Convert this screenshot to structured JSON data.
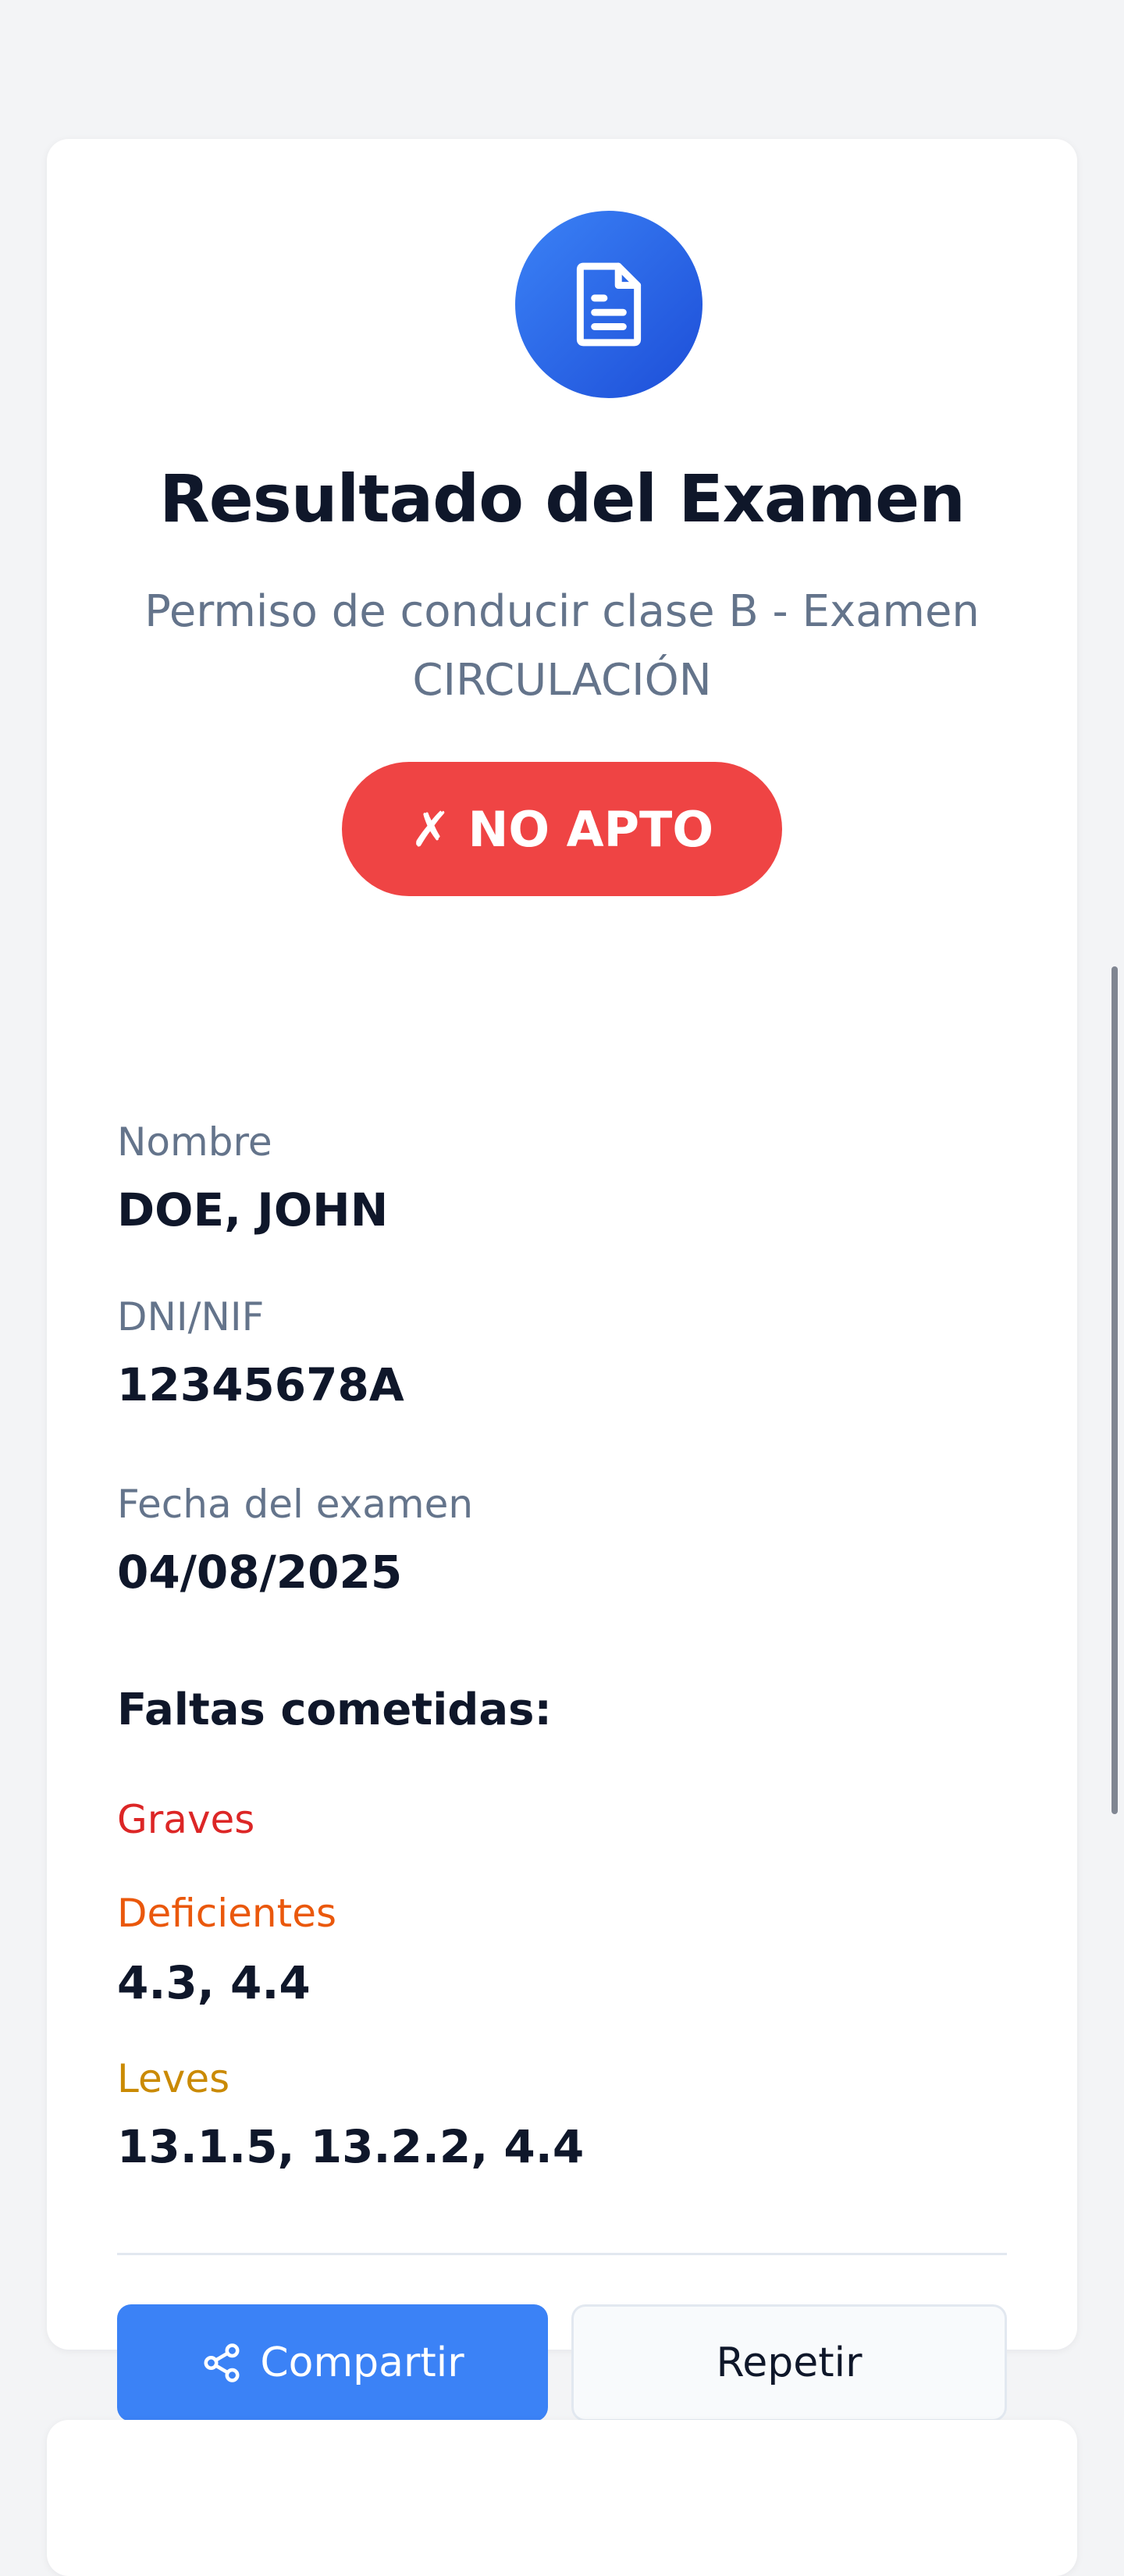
{
  "header": {
    "icon": "document-icon",
    "title": "Resultado del Examen",
    "subtitle": "Permiso de conducir clase B - Examen CIRCULACIÓN"
  },
  "result": {
    "label": "✗ NO APTO",
    "color": "#ef4444"
  },
  "fields": {
    "name_label": "Nombre",
    "name_value": "DOE, JOHN",
    "id_label": "DNI/NIF",
    "id_value": "12345678A",
    "date_label": "Fecha del examen",
    "date_value": "04/08/2025"
  },
  "faults": {
    "title": "Faltas cometidas:",
    "graves_label": "Graves",
    "deficientes_label": "Deficientes",
    "deficientes_value": "4.3, 4.4",
    "leves_label": "Leves",
    "leves_value": "13.1.5, 13.2.2, 4.4",
    "colors": {
      "graves": "#dc2626",
      "deficientes": "#ea580c",
      "leves": "#ca8a04"
    }
  },
  "actions": {
    "share_label": "Compartir",
    "share_icon": "share-icon",
    "repeat_label": "Repetir",
    "accent": "#3b82f6"
  }
}
